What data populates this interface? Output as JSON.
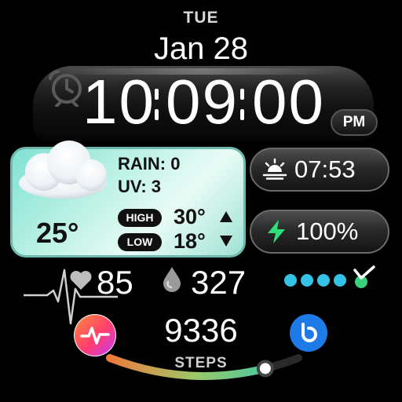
{
  "header": {
    "day": "TUE",
    "date": "Jan 28"
  },
  "time": {
    "hours": "10",
    "minutes": "09",
    "seconds": "00",
    "ampm": "PM"
  },
  "weather": {
    "temperature": "25°",
    "rain": "RAIN: 0",
    "uv": "UV: 3",
    "high_label": "HIGH",
    "high_value": "30°",
    "low_label": "LOW",
    "low_value": "18°",
    "icon": "cloud-icon"
  },
  "sunrise": {
    "time": "07:53",
    "icon": "sunrise-icon"
  },
  "battery": {
    "value": "100%",
    "icon": "bolt-icon"
  },
  "health": {
    "heart_rate": "85",
    "heart_icon": "heart-icon",
    "water": "327",
    "water_icon": "drop-icon"
  },
  "goal_dots": {
    "count": 5,
    "completed_icon": "check-icon",
    "color": "#34c3e6"
  },
  "steps": {
    "value": "9336",
    "label": "STEPS",
    "progress": 0.82
  },
  "colors": {
    "accent_teal": "#27c9b2",
    "bolt_green": "#2ee07a",
    "bixby_blue": "#1d7ae6"
  }
}
